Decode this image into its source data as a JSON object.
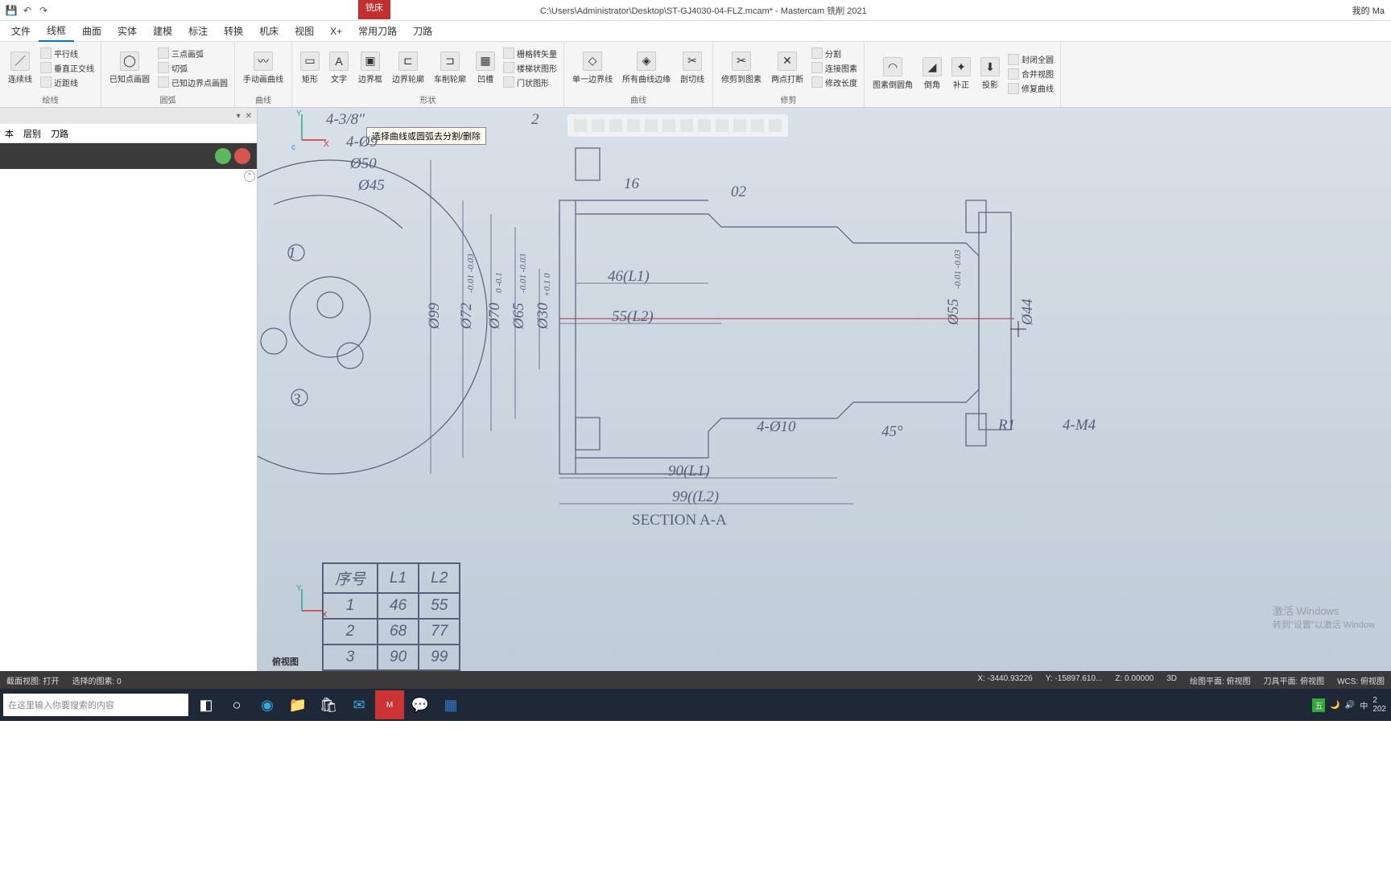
{
  "title": {
    "path": "C:\\Users\\Administrator\\Desktop\\ST-GJ4030-04-FLZ.mcam* - Mastercam 铣削 2021",
    "right": "我的 Ma",
    "context_tab": "铣床"
  },
  "qat": {
    "save": "💾",
    "undo": "↶",
    "redo": "↷"
  },
  "tabs": [
    "文件",
    "线框",
    "曲面",
    "实体",
    "建模",
    "标注",
    "转换",
    "机床",
    "视图",
    "X+",
    "常用刀路",
    "刀路"
  ],
  "active_tab": 1,
  "ribbon": {
    "groups": [
      {
        "label": "绘线",
        "big": [
          {
            "icon": "／",
            "label": "连续线"
          }
        ],
        "small": [
          "平行线",
          "垂直正交线",
          "近距线"
        ]
      },
      {
        "label": "圆弧",
        "big": [
          {
            "icon": "◯",
            "label": "已知点画圆"
          }
        ],
        "small": [
          "三点画弧",
          "切弧",
          "已知边界点画圆"
        ]
      },
      {
        "label": "曲线",
        "big": [
          {
            "icon": "〰",
            "label": "手动画曲线"
          }
        ]
      },
      {
        "label": "形状",
        "big": [
          {
            "icon": "▭",
            "label": "矩形"
          },
          {
            "icon": "A",
            "label": "文字"
          },
          {
            "icon": "▣",
            "label": "边界框"
          },
          {
            "icon": "⊏",
            "label": "边界轮廓"
          },
          {
            "icon": "⊐",
            "label": "车削轮廓"
          },
          {
            "icon": "▦",
            "label": "凹槽"
          }
        ],
        "small": [
          "栅格转矢量",
          "楼梯状图形",
          "门状图形"
        ]
      },
      {
        "label": "曲线",
        "big": [
          {
            "icon": "◇",
            "label": "单一边界线"
          },
          {
            "icon": "◈",
            "label": "所有曲线边缘"
          },
          {
            "icon": "✂",
            "label": "剖切线"
          }
        ]
      },
      {
        "label": "修剪",
        "big": [
          {
            "icon": "✂",
            "label": "修剪到图素"
          },
          {
            "icon": "✕",
            "label": "两点打断"
          }
        ],
        "small": [
          "分割",
          "连接图素",
          "修改长度"
        ]
      },
      {
        "label": "",
        "big": [
          {
            "icon": "◠",
            "label": "图素倒圆角"
          },
          {
            "icon": "◢",
            "label": "倒角"
          },
          {
            "icon": "✦",
            "label": "补正"
          },
          {
            "icon": "⬇",
            "label": "投影"
          }
        ],
        "small": [
          "封闭全圆",
          "合并视图",
          "修复曲线"
        ]
      }
    ]
  },
  "panel": {
    "hdr_icons": [
      "▾",
      "✕"
    ],
    "tabs": [
      "本",
      "层别",
      "刀路"
    ]
  },
  "tooltip": "选择曲线或圆弧去分割/删除",
  "drawing": {
    "dims": {
      "d1": "4-3/8″",
      "d2": "4-Ø9",
      "d3": "Ø50",
      "d4": "Ø45",
      "v1": "Ø99",
      "v2": "Ø72",
      "v2t": "-0.01\n-0.03",
      "v3": "Ø70",
      "v3t": "0\n-0.1",
      "v4": "Ø65",
      "v4t": "-0.01\n-0.03",
      "v5": "Ø30",
      "v5t": "+0.1\n 0",
      "h1": "46(L1)",
      "h2": "55(L2)",
      "h3": "90(L1)",
      "h4": "99((L2)",
      "t1": "2",
      "t2": "16",
      "t3": "02",
      "r1": "Ø55",
      "r1t": "-0.01\n-0.03",
      "r2": "Ø44",
      "r3": "R1",
      "r4": "4-M4",
      "a1": "45°",
      "a2": "4-Ø10",
      "section": "SECTION A-A",
      "n1": "1",
      "n2": "3"
    },
    "table": {
      "headers": [
        "序号",
        "L1",
        "L2"
      ],
      "rows": [
        [
          "1",
          "46",
          "55"
        ],
        [
          "2",
          "68",
          "77"
        ],
        [
          "3",
          "90",
          "99"
        ]
      ]
    },
    "view_label": "俯视图"
  },
  "watermark": {
    "l1": "激活 Windows",
    "l2": "转到\"设置\"以激活 Window"
  },
  "statusbar": {
    "left": [
      "截面视图: 打开",
      "选择的图素: 0"
    ],
    "right": [
      "X: -3440.93226",
      "Y: -15897.610...",
      "Z: 0.00000",
      "3D",
      "绘图平面: 俯视图",
      "刀具平面: 俯视图",
      "WCS: 俯视图"
    ]
  },
  "taskbar": {
    "search_placeholder": "在这里输入你要搜索的内容",
    "tray": [
      "五",
      "🔊",
      "中",
      "2",
      "202"
    ]
  }
}
